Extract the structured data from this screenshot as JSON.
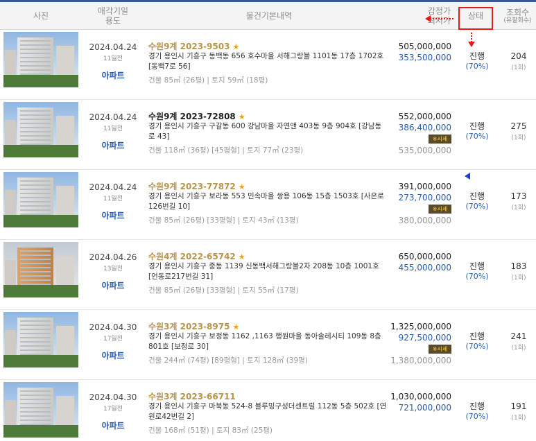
{
  "header": {
    "photo": "사진",
    "date_line1": "매각기일",
    "date_line2": "용도",
    "info": "물건기본내역",
    "price_line1": "감정가",
    "price_line2": "최저가",
    "status": "상태",
    "views_line1": "조회수",
    "views_line2": "(유찰회수)"
  },
  "listings": [
    {
      "date": "2024.04.24",
      "ago": "11일전",
      "use": "아파트",
      "case": "수원9계 2023-9503",
      "starred": true,
      "address": "경기 용인시 기흥구 동백동 656 호수마을 서해그랑블 1101동 17층 1702호 [동백7로 56]",
      "area": "건물 85㎡ (26평)  |  토지 59㎡ (18평)",
      "appraisal": "505,000,000",
      "minimum": "353,500,000",
      "market_badge": "",
      "market": "",
      "status": "진행",
      "percent": "(70%)",
      "views": "204",
      "rounds": "(1회)"
    },
    {
      "date": "2024.04.24",
      "ago": "11일전",
      "use": "아파트",
      "case": "수원9계 2023-72808",
      "starred": true,
      "address": "경기 용인시 기흥구 구갈동 600 강남마을 자연앤 403동 9층 904호 [강남동로 43]",
      "area": "건물 118㎡ (36평) [45평형]  |  토지 77㎡ (23평)",
      "appraisal": "552,000,000",
      "minimum": "386,400,000",
      "market_badge": "※시세",
      "market": "535,000,000",
      "status": "진행",
      "percent": "(70%)",
      "views": "275",
      "rounds": "(1회)"
    },
    {
      "date": "2024.04.24",
      "ago": "11일전",
      "use": "아파트",
      "case": "수원9계 2023-77872",
      "starred": true,
      "address": "경기 용인시 기흥구 보라동 553 민속마을 쌍용 106동 15층 1503호 [사은로126번길 10]",
      "area": "건물 85㎡ (26평) [33평형]  |  토지 43㎡ (13평)",
      "appraisal": "391,000,000",
      "minimum": "273,700,000",
      "market_badge": "※시세",
      "market": "380,000,000",
      "status": "진행",
      "percent": "(70%)",
      "views": "173",
      "rounds": "(1회)"
    },
    {
      "date": "2024.04.26",
      "ago": "13일전",
      "use": "아파트",
      "case": "수원4계 2022-65742",
      "starred": true,
      "address": "경기 용인시 기흥구 중동 1139 신동백서해그랑블2차 208동 10층 1001호 [언동로217번길 31]",
      "area": "건물 85㎡ (26평) [33평형]  |  토지 55㎡ (17평)",
      "appraisal": "650,000,000",
      "minimum": "455,000,000",
      "market_badge": "",
      "market": "",
      "status": "진행",
      "percent": "(70%)",
      "views": "183",
      "rounds": "(1회)"
    },
    {
      "date": "2024.04.30",
      "ago": "17일전",
      "use": "아파트",
      "case": "수원3계 2023-8975",
      "starred": true,
      "address": "경기 용인시 기흥구 보정동 1162 ,1163 행원마을 동아솔레시티 109동 8층 801호 [보정로 30]",
      "area": "건물 244㎡ (74평) [89평형]  |  토지 128㎡ (39평)",
      "appraisal": "1,325,000,000",
      "minimum": "927,500,000",
      "market_badge": "※시세",
      "market": "1,380,000,000",
      "status": "진행",
      "percent": "(70%)",
      "views": "241",
      "rounds": "(1회)"
    },
    {
      "date": "2024.04.30",
      "ago": "17일전",
      "use": "아파트",
      "case": "수원3계 2023-66711",
      "starred": false,
      "address": "경기 용인시 기흥구 마북동 524-8 블루밍구성더센트럴 112동 5층 502호 [연원로42번길 2]",
      "area": "건물 168㎡ (51평)  |  토지 83㎡ (25평)",
      "appraisal": "1,030,000,000",
      "minimum": "721,000,000",
      "market_badge": "",
      "market": "",
      "status": "진행",
      "percent": "(70%)",
      "views": "191",
      "rounds": "(1회)"
    }
  ],
  "star_glyph": "★"
}
